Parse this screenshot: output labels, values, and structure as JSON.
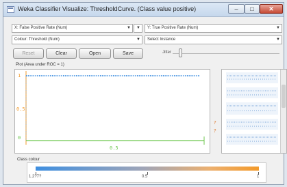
{
  "window": {
    "title": "Weka Classifier Visualize: ThresholdCurve. (Class value positive)",
    "minimize_symbol": "–",
    "maximize_symbol": "□",
    "close_symbol": "✕"
  },
  "controls": {
    "x_axis": "X: False Positive Rate (Num)",
    "y_axis": "Y: True Positive Rate (Num)",
    "colour": "Colour: Threshold (Num)",
    "select_instance": "Select Instance",
    "buttons": [
      "Reset",
      "Clear",
      "Open",
      "Save"
    ],
    "jitter_label": "Jitter"
  },
  "plot": {
    "title": "Plot (Area under ROC = 1)",
    "y_ticks": [
      "1",
      "0.5",
      "0"
    ],
    "x_tick": "0.5",
    "colors": {
      "points": "#3f8fe0",
      "line": "#6cc64d",
      "axis": "#f39a2a"
    }
  },
  "class_colour": {
    "label": "Class colour",
    "ticks": [
      "1.2?7?",
      "0.5",
      "1"
    ]
  }
}
